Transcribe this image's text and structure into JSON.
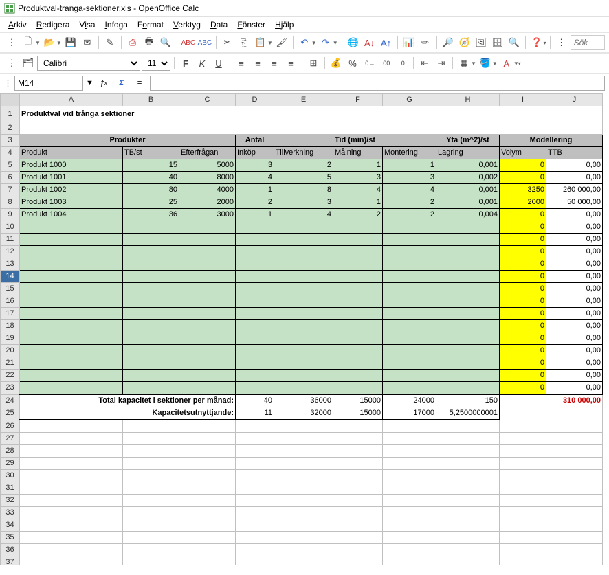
{
  "window": {
    "title": "Produktval-tranga-sektioner.xls - OpenOffice Calc"
  },
  "menu": [
    "Arkiv",
    "Redigera",
    "Visa",
    "Infoga",
    "Format",
    "Verktyg",
    "Data",
    "Fönster",
    "Hjälp"
  ],
  "font": {
    "name": "Calibri",
    "size": "11"
  },
  "search": {
    "placeholder": "Sök"
  },
  "cellref": "M14",
  "formula": "",
  "columns": [
    "A",
    "B",
    "C",
    "D",
    "E",
    "F",
    "G",
    "H",
    "I",
    "J"
  ],
  "sheet": {
    "title": "Produktval vid trånga sektioner",
    "groupHeaders": {
      "produkter": "Produkter",
      "antal": "Antal",
      "tid": "Tid (min)/st",
      "yta": "Yta (m^2)/st",
      "modellering": "Modellering"
    },
    "subHeaders": {
      "produkt": "Produkt",
      "tbst": "TB/st",
      "efterfragan": "Efterfrågan",
      "inkop": "Inköp",
      "tillverkning": "Tillverkning",
      "malning": "Målning",
      "montering": "Montering",
      "lagring": "Lagring",
      "volym": "Volym",
      "ttb": "TTB"
    },
    "products": [
      {
        "name": "Produkt 1000",
        "tb": "15",
        "eft": "5000",
        "ink": "3",
        "til": "2",
        "mal": "1",
        "mon": "1",
        "lag": "0,001",
        "vol": "0",
        "ttb": "0,00"
      },
      {
        "name": "Produkt 1001",
        "tb": "40",
        "eft": "8000",
        "ink": "4",
        "til": "5",
        "mal": "3",
        "mon": "3",
        "lag": "0,002",
        "vol": "0",
        "ttb": "0,00"
      },
      {
        "name": "Produkt 1002",
        "tb": "80",
        "eft": "4000",
        "ink": "1",
        "til": "8",
        "mal": "4",
        "mon": "4",
        "lag": "0,001",
        "vol": "3250",
        "ttb": "260 000,00"
      },
      {
        "name": "Produkt 1003",
        "tb": "25",
        "eft": "2000",
        "ink": "2",
        "til": "3",
        "mal": "1",
        "mon": "2",
        "lag": "0,001",
        "vol": "2000",
        "ttb": "50 000,00"
      },
      {
        "name": "Produkt 1004",
        "tb": "36",
        "eft": "3000",
        "ink": "1",
        "til": "4",
        "mal": "2",
        "mon": "2",
        "lag": "0,004",
        "vol": "0",
        "ttb": "0,00"
      }
    ],
    "emptyRows": 14,
    "totalLabel": "Total kapacitet i sektioner per månad:",
    "totals": {
      "ink": "40",
      "til": "36000",
      "mal": "15000",
      "mon": "24000",
      "lag": "150",
      "ttb": "310 000,00"
    },
    "utilLabel": "Kapacitetsutnyttjande:",
    "util": {
      "ink": "11",
      "til": "32000",
      "mal": "15000",
      "mon": "17000",
      "lag": "5,2500000001"
    }
  }
}
